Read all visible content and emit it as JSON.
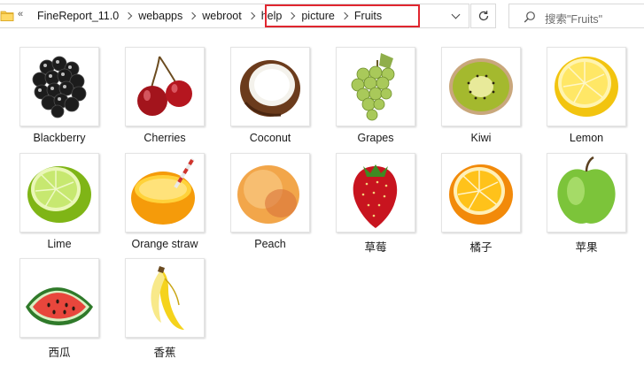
{
  "address_bar": {
    "lead_separator": "«",
    "breadcrumbs": [
      "FineReport_11.0",
      "webapps",
      "webroot",
      "help",
      "picture",
      "Fruits"
    ]
  },
  "search": {
    "placeholder": "搜索\"Fruits\""
  },
  "files": [
    {
      "name": "Blackberry",
      "icon": "blackberry-icon"
    },
    {
      "name": "Cherries",
      "icon": "cherries-icon"
    },
    {
      "name": "Coconut",
      "icon": "coconut-icon"
    },
    {
      "name": "Grapes",
      "icon": "grapes-icon"
    },
    {
      "name": "Kiwi",
      "icon": "kiwi-icon"
    },
    {
      "name": "Lemon",
      "icon": "lemon-icon"
    },
    {
      "name": "Lime",
      "icon": "lime-icon"
    },
    {
      "name": "Orange straw",
      "icon": "orange-straw-icon"
    },
    {
      "name": "Peach",
      "icon": "peach-icon"
    },
    {
      "name": "草莓",
      "icon": "strawberry-icon"
    },
    {
      "name": "橘子",
      "icon": "tangerine-icon"
    },
    {
      "name": "苹果",
      "icon": "apple-icon"
    },
    {
      "name": "西瓜",
      "icon": "watermelon-icon"
    },
    {
      "name": "香蕉",
      "icon": "banana-icon"
    }
  ],
  "colors": {
    "highlight_border": "#e0262f",
    "folder_yellow": "#f5c84c"
  }
}
